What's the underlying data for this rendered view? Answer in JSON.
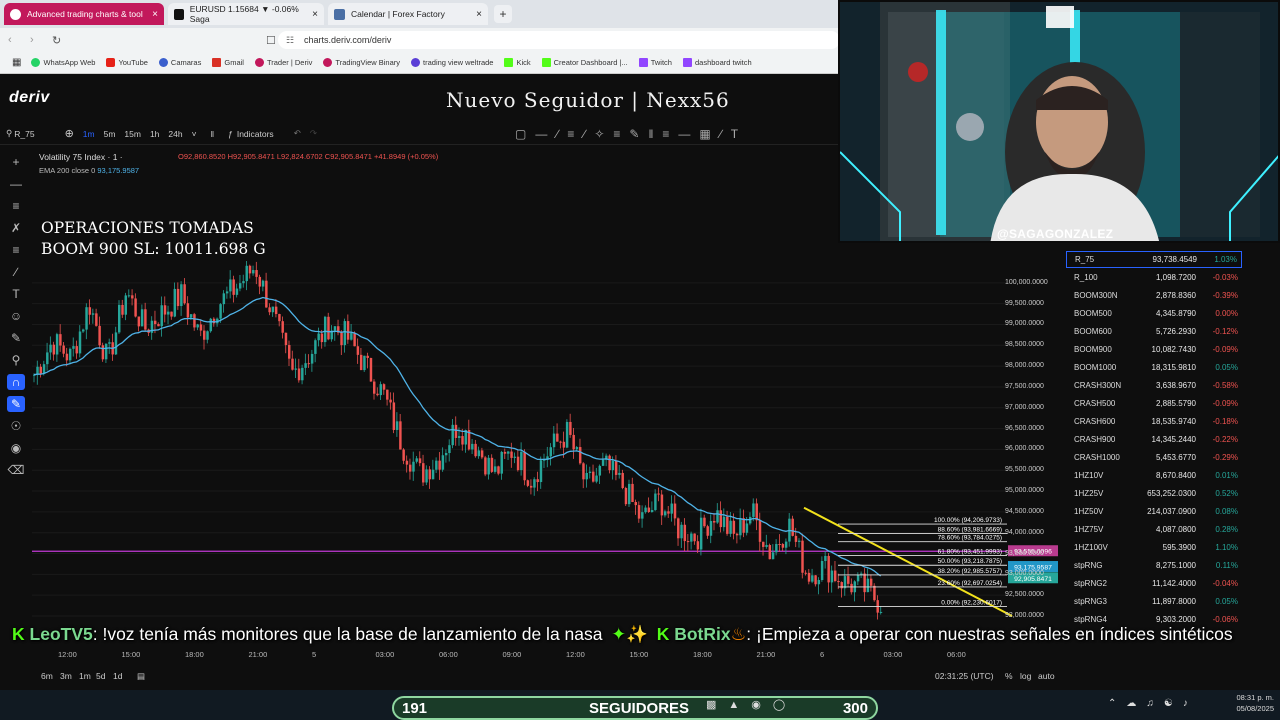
{
  "browser": {
    "tabs": [
      {
        "label": "Advanced trading charts & tool",
        "active": true,
        "close": "×"
      },
      {
        "label": "EURUSD 1.15684 ▼ -0.06% Saga",
        "active": false,
        "close": "×"
      },
      {
        "label": "Calendar | Forex Factory",
        "active": false,
        "close": "×"
      }
    ],
    "new_tab": "+",
    "url": "charts.deriv.com/deriv",
    "bookmarks": [
      "WhatsApp Web",
      "YouTube",
      "Camaras",
      "Gmail",
      "Trader | Deriv",
      "TradingView Binary",
      "trading view weltrade",
      "Kick",
      "Creator Dashboard |...",
      "Twitch",
      "dashboard twitch"
    ]
  },
  "app": {
    "logo": "deriv",
    "overlay_title": "Nuevo Seguidor | Nexx56",
    "symbol_search": "R_75",
    "timeframes": [
      "1m",
      "5m",
      "15m",
      "1h",
      "24h"
    ],
    "active_timeframe": "1m",
    "indicators_label": "Indicators",
    "instrument": "Volatility 75 Index · 1 ·",
    "ohlc": "O92,860.8520 H92,905.8471 L92,824.6702 C92,905.8471 +41.8949 (+0.05%)",
    "ema_label": "EMA 200 close 0",
    "ema_value": "93,175.9587",
    "ops_line1": "OPERACIONES TOMADAS",
    "ops_line2": "BOOM 900 SL: 10011.698 G"
  },
  "chart_data": {
    "type": "line",
    "series": [
      {
        "values": [
          97800,
          98600,
          98200,
          99500,
          98100,
          99800,
          98900,
          99300,
          99700,
          98700,
          99500,
          99900,
          100400,
          99200,
          97800,
          98300,
          99000,
          98700,
          98000,
          97300,
          96100,
          95400,
          95800,
          96600,
          96100,
          95400,
          96000,
          95300,
          96000,
          96400,
          95100,
          95600,
          95100,
          94300,
          94800,
          94100,
          93900,
          94500,
          93900,
          94500,
          93500,
          94200,
          93000,
          93200,
          92800,
          92700,
          92300
        ]
      }
    ],
    "ylim": [
      92000,
      100500
    ],
    "y_ticks": [
      "100,000.0000",
      "99,500.0000",
      "99,000.0000",
      "98,500.0000",
      "98,000.0000",
      "97,500.0000",
      "97,000.0000",
      "96,500.0000",
      "96,000.0000",
      "95,500.0000",
      "95,000.0000",
      "94,500.0000",
      "94,000.0000",
      "93,500.0000",
      "93,000.0000",
      "92,500.0000",
      "92,000.0000"
    ],
    "x_ticks": [
      "12:00",
      "15:00",
      "18:00",
      "21:00",
      "5",
      "03:00",
      "06:00",
      "09:00",
      "12:00",
      "15:00",
      "18:00",
      "21:00",
      "6",
      "03:00",
      "06:00"
    ],
    "fib_levels": [
      {
        "label": "100.00% (94,206.9733)",
        "value": 94206.9733
      },
      {
        "label": "88.60% (93,981.6669)",
        "value": 93981.6669
      },
      {
        "label": "78.60% (93,784.0275)",
        "value": 93784.0275
      },
      {
        "label": "61.80% (93,451.9993)",
        "value": 93451.9993
      },
      {
        "label": "50.00% (93,218.7875)",
        "value": 93218.7875
      },
      {
        "label": "38.20% (92,985.5757)",
        "value": 92985.5757
      },
      {
        "label": "23.60% (92,697.0254)",
        "value": 92697.0254
      },
      {
        "label": "0.00% (92,230.6017)",
        "value": 92230.6017
      }
    ],
    "price_badges": [
      {
        "text": "93,555.0096",
        "color": "#b93b8f"
      },
      {
        "text": "93,175.9587",
        "color": "#2196c7"
      },
      {
        "text": "92,905.8471",
        "color": "#26a69a"
      }
    ]
  },
  "axis_bottom": {
    "time": "02:31:25 (UTC)",
    "pct": "%",
    "log": "log",
    "auto": "auto",
    "ranges": [
      "6m",
      "3m",
      "1m",
      "5d",
      "1d"
    ]
  },
  "watchlist": [
    {
      "name": "R_75",
      "price": "93,738.4549",
      "change": "1.03%",
      "up": true
    },
    {
      "name": "R_100",
      "price": "1,098.7200",
      "change": "-0.03%",
      "up": false
    },
    {
      "name": "BOOM300N",
      "price": "2,878.8360",
      "change": "-0.39%",
      "up": false
    },
    {
      "name": "BOOM500",
      "price": "4,345.8790",
      "change": "0.00%",
      "up": false
    },
    {
      "name": "BOOM600",
      "price": "5,726.2930",
      "change": "-0.12%",
      "up": false
    },
    {
      "name": "BOOM900",
      "price": "10,082.7430",
      "change": "-0.09%",
      "up": false
    },
    {
      "name": "BOOM1000",
      "price": "18,315.9810",
      "change": "0.05%",
      "up": true
    },
    {
      "name": "CRASH300N",
      "price": "3,638.9670",
      "change": "-0.58%",
      "up": false
    },
    {
      "name": "CRASH500",
      "price": "2,885.5790",
      "change": "-0.09%",
      "up": false
    },
    {
      "name": "CRASH600",
      "price": "18,535.9740",
      "change": "-0.18%",
      "up": false
    },
    {
      "name": "CRASH900",
      "price": "14,345.2440",
      "change": "-0.22%",
      "up": false
    },
    {
      "name": "CRASH1000",
      "price": "5,453.6770",
      "change": "-0.29%",
      "up": false
    },
    {
      "name": "1HZ10V",
      "price": "8,670.8400",
      "change": "0.01%",
      "up": true
    },
    {
      "name": "1HZ25V",
      "price": "653,252.0300",
      "change": "0.52%",
      "up": true
    },
    {
      "name": "1HZ50V",
      "price": "214,037.0900",
      "change": "0.08%",
      "up": true
    },
    {
      "name": "1HZ75V",
      "price": "4,087.0800",
      "change": "0.28%",
      "up": true
    },
    {
      "name": "1HZ100V",
      "price": "595.3900",
      "change": "1.10%",
      "up": true
    },
    {
      "name": "stpRNG",
      "price": "8,275.1000",
      "change": "0.11%",
      "up": true
    },
    {
      "name": "stpRNG2",
      "price": "11,142.4000",
      "change": "-0.04%",
      "up": false
    },
    {
      "name": "stpRNG3",
      "price": "11,897.8000",
      "change": "0.05%",
      "up": true
    },
    {
      "name": "stpRNG4",
      "price": "9,303.2000",
      "change": "-0.06%",
      "up": false
    }
  ],
  "webcam": {
    "handle": "@SAGAGONZALEZ"
  },
  "ticker": {
    "user1": "LeoTV5",
    "msg1": ": !voz tenía más monitores que la base de lanzamiento de la nasa",
    "user2": "BotRix",
    "msg2": ": ¡Empieza a operar con nuestras señales en índices sintéticos"
  },
  "stream_bar": {
    "left_count": "191",
    "label": "SEGUIDORES",
    "right_count": "300"
  },
  "taskbar": {
    "time": "08:31 p. m.",
    "date": "05/08/2025"
  },
  "colors": {
    "accent": "#2962ff",
    "up": "#26a69a",
    "down": "#ef5350",
    "ema": "#4fb3e8",
    "magenta_line": "#c23ad6",
    "trend_yellow": "#f2e21c"
  }
}
